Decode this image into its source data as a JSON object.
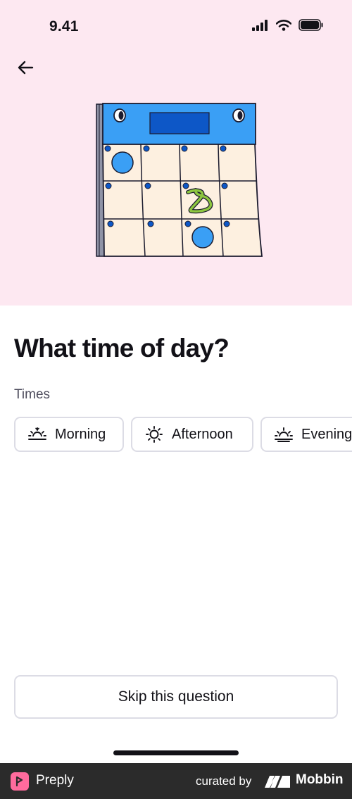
{
  "status_bar": {
    "time": "9.41"
  },
  "question": {
    "title": "What time of day?"
  },
  "section": {
    "label": "Times"
  },
  "chips": [
    {
      "label": "Morning",
      "icon": "sunrise-icon"
    },
    {
      "label": "Afternoon",
      "icon": "sun-icon"
    },
    {
      "label": "Evening",
      "icon": "sunset-icon"
    }
  ],
  "actions": {
    "skip_label": "Skip this question"
  },
  "footer": {
    "brand": "Preply",
    "curated_label": "curated by",
    "curator": "Mobbin"
  },
  "colors": {
    "hero_bg": "#fde8f1",
    "accent_blue": "#3a9ff5",
    "dark_blue": "#0d57c7",
    "paper": "#fdf0e0",
    "footer_bg": "#2b2b2b",
    "preply_pink": "#ff6b9d"
  }
}
